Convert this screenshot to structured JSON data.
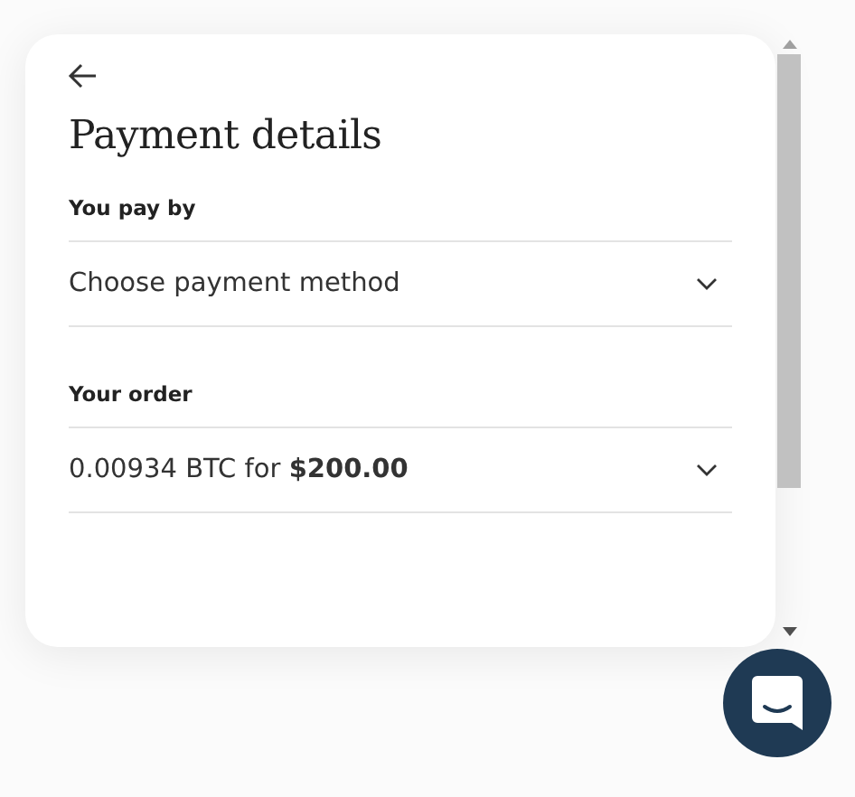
{
  "panel": {
    "title": "Payment details",
    "sections": [
      {
        "label": "You pay by",
        "value": "Choose payment method"
      },
      {
        "label": "Your order",
        "value": "0.00934 BTC for **$200.00**"
      }
    ]
  },
  "chat_button": {
    "kind": "chat"
  }
}
